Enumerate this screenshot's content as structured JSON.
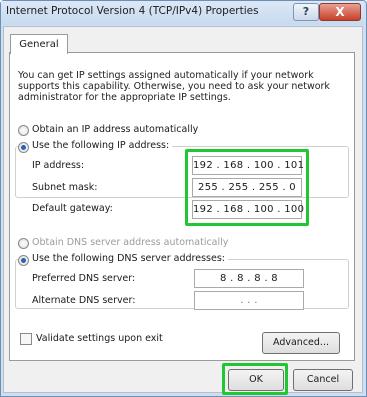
{
  "window": {
    "title": "Internet Protocol Version 4 (TCP/IPv4) Properties",
    "help_label": "?",
    "close_label": "X"
  },
  "tabs": [
    {
      "label": "General"
    }
  ],
  "description": "You can get IP settings assigned automatically if your network supports this capability. Otherwise, you need to ask your network administrator for the appropriate IP settings.",
  "ip_settings": {
    "auto_label": "Obtain an IP address automatically",
    "manual_label": "Use the following IP address:",
    "selected": "manual",
    "fields": [
      {
        "label": "IP address:",
        "value": "192 . 168 . 100 . 101"
      },
      {
        "label": "Subnet mask:",
        "value": "255 . 255 . 255 .  0"
      },
      {
        "label": "Default gateway:",
        "value": "192 . 168 . 100 . 100"
      }
    ]
  },
  "dns_settings": {
    "auto_label": "Obtain DNS server address automatically",
    "manual_label": "Use the following DNS server addresses:",
    "selected": "manual",
    "fields": [
      {
        "label": "Preferred DNS server:",
        "value": "8  .  8  .  8  .  8"
      },
      {
        "label": "Alternate DNS server:",
        "value": ".      .      ."
      }
    ]
  },
  "validate_label": "Validate settings upon exit",
  "validate_checked": false,
  "buttons": {
    "advanced": "Advanced...",
    "ok": "OK",
    "cancel": "Cancel"
  },
  "colors": {
    "highlight": "#21c633",
    "title_bar": "#cfdff0",
    "close": "#c8402b"
  }
}
